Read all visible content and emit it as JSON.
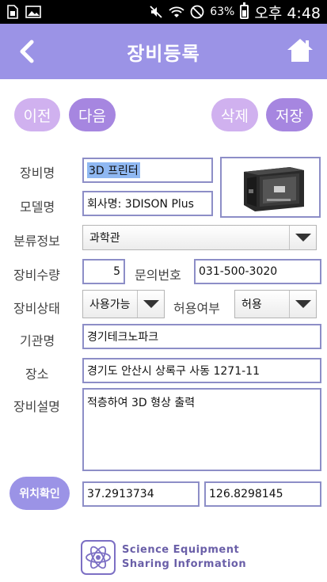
{
  "status_bar": {
    "battery_percent": "63%",
    "time": "오후 4:48",
    "left_icons": [
      "sim-card-icon",
      "image-icon"
    ],
    "right_icons": [
      "mute-icon",
      "wifi-icon",
      "no-entry-icon",
      "battery-icon"
    ]
  },
  "app_bar": {
    "title": "장비등록",
    "color": "#9b93e6"
  },
  "actions": {
    "prev": "이전",
    "next": "다음",
    "delete": "삭제",
    "save": "저장"
  },
  "form": {
    "equipment_name_label": "장비명",
    "equipment_name_value": "3D 프린터",
    "model_name_label": "모델명",
    "model_name_value": "회사명: 3DISON Plus",
    "category_label": "분류정보",
    "category_value": "과학관",
    "quantity_label": "장비수량",
    "quantity_value": "5",
    "inquiry_label": "문의번호",
    "inquiry_value": "031-500-3020",
    "status_label": "장비상태",
    "status_value": "사용가능",
    "permission_label": "허용여부",
    "permission_value": "허용",
    "institution_label": "기관명",
    "institution_value": "경기테크노파크",
    "location_label": "장소",
    "location_value": "경기도 안산시 상록구 사동 1271-11",
    "description_label": "장비설명",
    "description_value": "적층하여 3D 형상 출력"
  },
  "location": {
    "button_label": "위치확인",
    "latitude": "37.2913734",
    "longitude": "126.8298145"
  },
  "footer": {
    "line1": "Science Equipment",
    "line2": "Sharing Information"
  }
}
